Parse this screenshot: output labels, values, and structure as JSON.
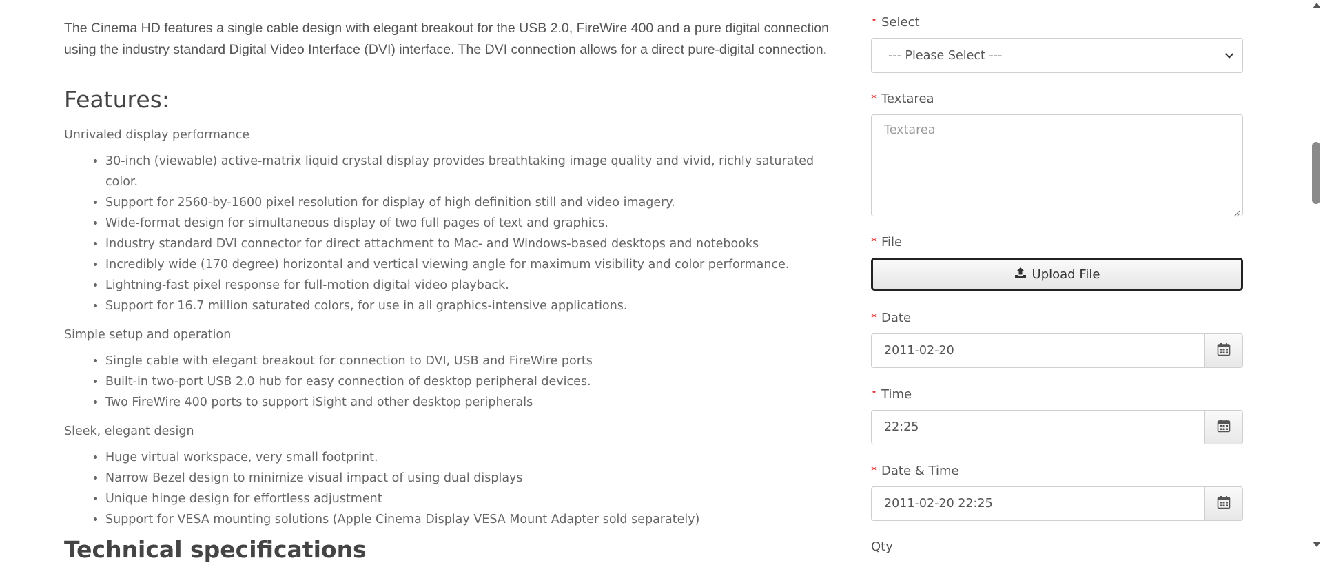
{
  "description": {
    "intro": "The Cinema HD features a single cable design with elegant breakout for the USB 2.0, FireWire 400 and a pure digital connection using the industry standard Digital Video Interface (DVI) interface. The DVI connection allows for a direct pure-digital connection.",
    "features_title": "Features:",
    "groups": [
      {
        "title": "Unrivaled display performance",
        "items": [
          "30-inch (viewable) active-matrix liquid crystal display provides breathtaking image quality and vivid, richly saturated color.",
          "Support for 2560-by-1600 pixel resolution for display of high definition still and video imagery.",
          "Wide-format design for simultaneous display of two full pages of text and graphics.",
          "Industry standard DVI connector for direct attachment to Mac- and Windows-based desktops and notebooks",
          "Incredibly wide (170 degree) horizontal and vertical viewing angle for maximum visibility and color performance.",
          "Lightning-fast pixel response for full-motion digital video playback.",
          "Support for 16.7 million saturated colors, for use in all graphics-intensive applications."
        ]
      },
      {
        "title": "Simple setup and operation",
        "items": [
          "Single cable with elegant breakout for connection to DVI, USB and FireWire ports",
          "Built-in two-port USB 2.0 hub for easy connection of desktop peripheral devices.",
          "Two FireWire 400 ports to support iSight and other desktop peripherals"
        ]
      },
      {
        "title": "Sleek, elegant design",
        "items": [
          "Huge virtual workspace, very small footprint.",
          "Narrow Bezel design to minimize visual impact of using dual displays",
          "Unique hinge design for effortless adjustment",
          "Support for VESA mounting solutions (Apple Cinema Display VESA Mount Adapter sold separately)"
        ]
      }
    ],
    "tech_title": "Technical specifications"
  },
  "options": {
    "required_marker": "*",
    "select": {
      "label": "Select",
      "value": "--- Please Select ---"
    },
    "textarea": {
      "label": "Textarea",
      "placeholder": "Textarea"
    },
    "file": {
      "label": "File",
      "button_label": "Upload File",
      "icon": "upload-icon"
    },
    "date": {
      "label": "Date",
      "value": "2011-02-20",
      "icon": "calendar-icon"
    },
    "time": {
      "label": "Time",
      "value": "22:25",
      "icon": "calendar-icon"
    },
    "datetime": {
      "label": "Date & Time",
      "value": "2011-02-20 22:25",
      "icon": "calendar-icon"
    },
    "qty": {
      "label": "Qty"
    }
  },
  "colors": {
    "required": "#e02020",
    "text": "#666666",
    "border": "#cfcfcf"
  }
}
